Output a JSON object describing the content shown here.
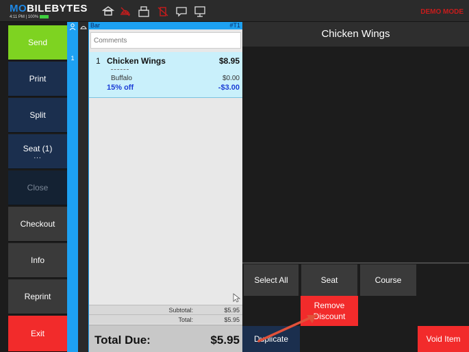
{
  "topbar": {
    "logo": "MOBILEBYTES",
    "logo_accent": "MO",
    "logo_rest": "BILEBYTES",
    "status": "4:11 PM | 100%",
    "demo": "DEMO MODE",
    "icons": [
      "table-icon",
      "no-service-icon",
      "printer-icon",
      "no-kitchen-icon",
      "chat-icon",
      "display-icon"
    ]
  },
  "left_buttons": {
    "send": "Send",
    "print": "Print",
    "split": "Split",
    "seat": "Seat (1)",
    "seat_more": "...",
    "close": "Close",
    "checkout": "Checkout",
    "info": "Info",
    "reprint": "Reprint",
    "exit": "Exit"
  },
  "seat_strip": {
    "seat_number": "1"
  },
  "ticket": {
    "location": "Bar",
    "ticket_number": "#T1",
    "comments_placeholder": "Comments",
    "items": [
      {
        "qty": "1",
        "name": "Chicken Wings",
        "price": "$8.95",
        "separator": "---------",
        "modifier": "Buffalo",
        "modifier_price": "$0.00",
        "discount": "15% off",
        "discount_value": "-$3.00"
      }
    ],
    "subtotal_label": "Subtotal:",
    "subtotal": "$5.95",
    "total_label": "Total:",
    "total": "$5.95",
    "total_due_label": "Total Due:",
    "total_due": "$5.95"
  },
  "right_panel": {
    "title": "Chicken Wings",
    "buttons": {
      "select_all": "Select All",
      "seat": "Seat",
      "course": "Course",
      "remove_discount": "Remove Discount",
      "duplicate": "Duplicate",
      "void_item": "Void Item"
    }
  },
  "colors": {
    "send": "#7ed321",
    "print": "#1b2f4e",
    "close": "#142233",
    "gray": "#3a3a3a",
    "exit": "#f22b2b",
    "seat_strip": "#1da1f2",
    "item_highlight": "#c9f0fb",
    "discount": "#1a3dd6",
    "demo": "#c81c1c"
  }
}
